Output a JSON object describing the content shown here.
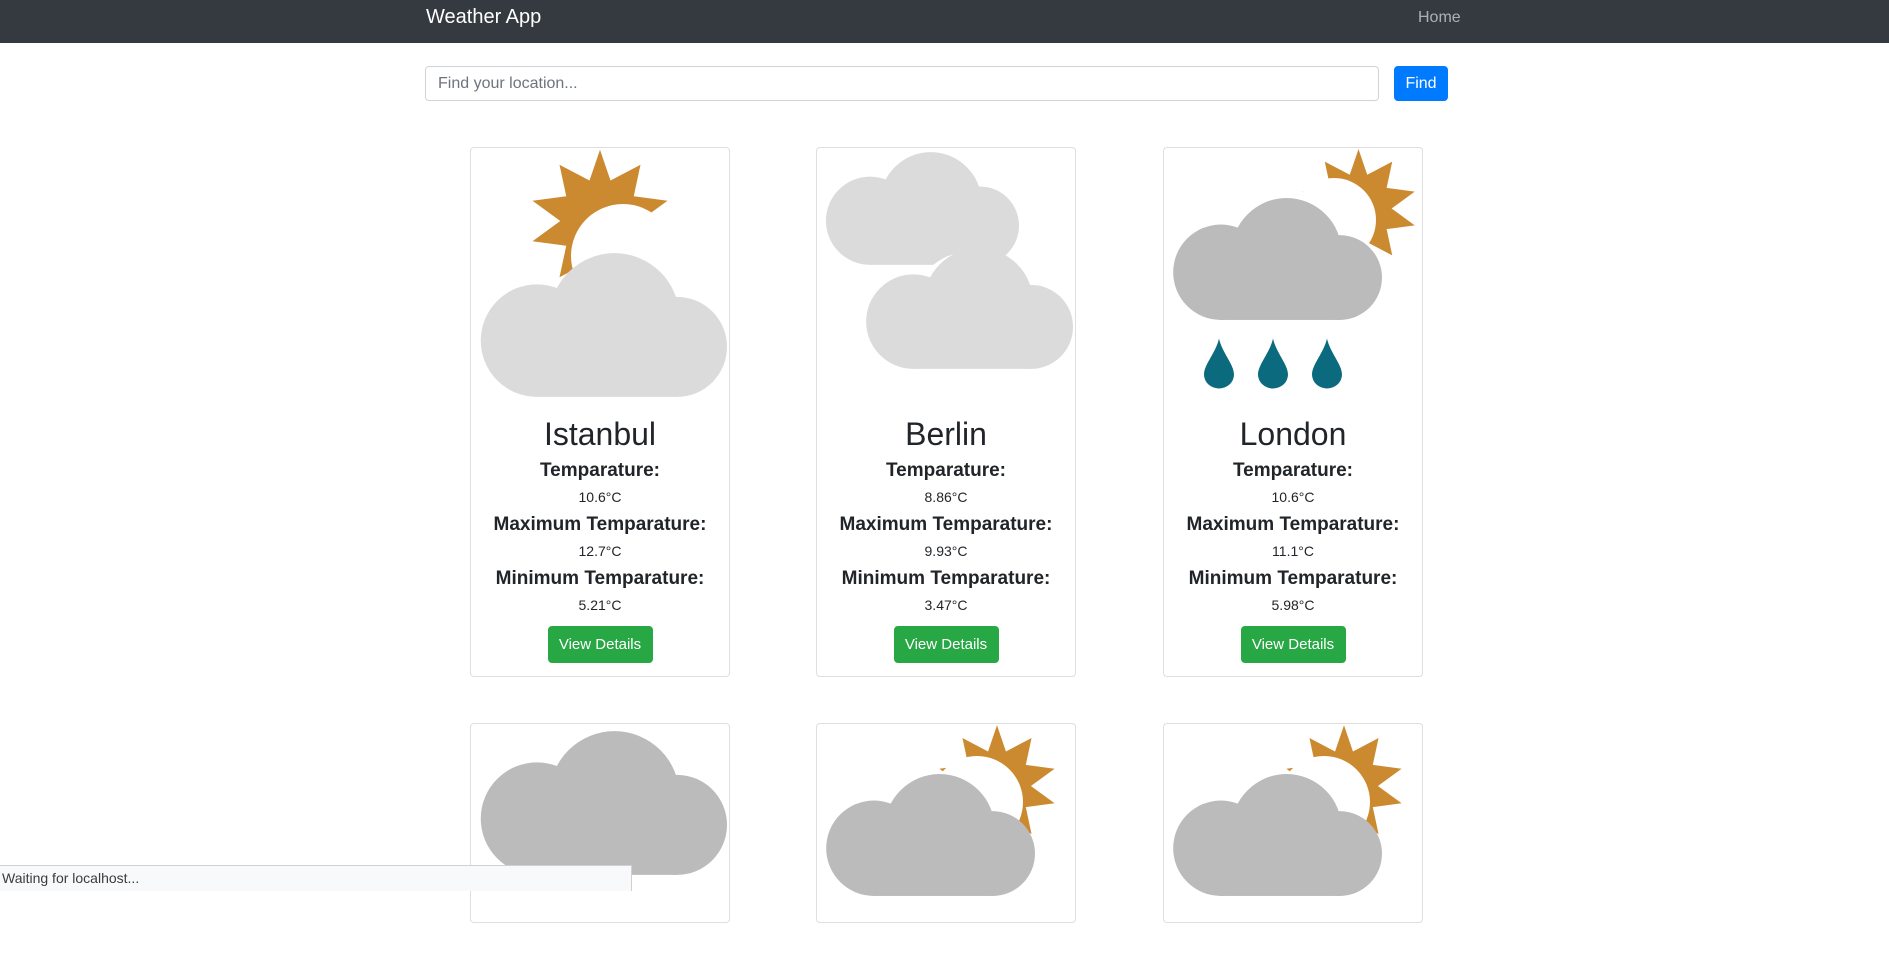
{
  "navbar": {
    "brand": "Weather App",
    "home_link": "Home"
  },
  "search": {
    "placeholder": "Find your location...",
    "value": "",
    "button_label": "Find"
  },
  "labels": {
    "temp": "Temparature:",
    "max": "Maximum Temparature:",
    "min": "Minimum Temparature:",
    "details": "View Details"
  },
  "cards": [
    {
      "city": "Istanbul",
      "icon": "partly-cloudy-icon",
      "temp": "10.6°C",
      "max": "12.7°C",
      "min": "5.21°C"
    },
    {
      "city": "Berlin",
      "icon": "cloudy-icon",
      "temp": "8.86°C",
      "max": "9.93°C",
      "min": "3.47°C"
    },
    {
      "city": "London",
      "icon": "rain-icon",
      "temp": "10.6°C",
      "max": "11.1°C",
      "min": "5.98°C"
    },
    {
      "city": "",
      "icon": "overcast-icon"
    },
    {
      "city": "",
      "icon": "partly-cloudy-dark-icon"
    },
    {
      "city": "",
      "icon": "partly-cloudy-dark-icon"
    }
  ],
  "status_bar": {
    "text": "Waiting for localhost..."
  },
  "colors": {
    "navbar": "#343a40",
    "primary": "#007bff",
    "success": "#28a745",
    "sun": "#cc8a30",
    "cloud_light": "#dcdbdc",
    "cloud_dark": "#bcbbbc",
    "rain": "#0b6a7e"
  }
}
